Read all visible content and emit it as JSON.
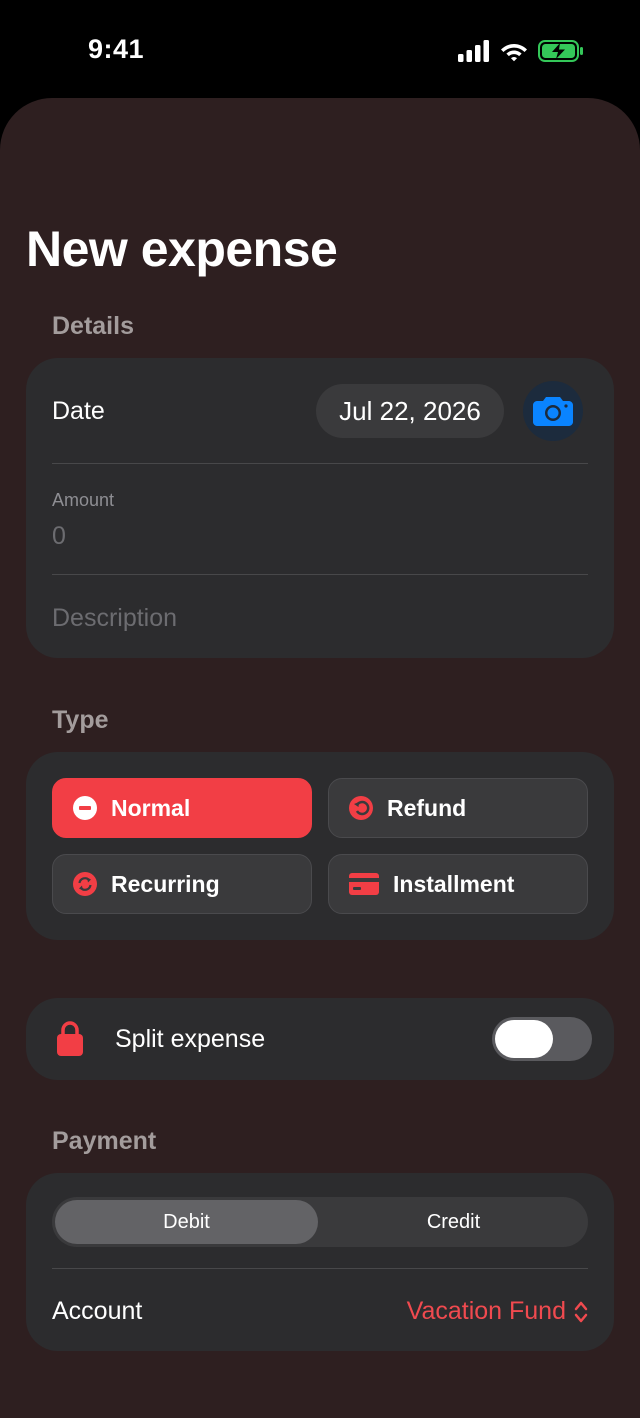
{
  "status_bar": {
    "time": "9:41"
  },
  "page": {
    "title": "New expense"
  },
  "details": {
    "section_label": "Details",
    "date_label": "Date",
    "date_value": "Jul 22, 2026",
    "amount_label": "Amount",
    "amount_placeholder": "0",
    "description_placeholder": "Description"
  },
  "type": {
    "section_label": "Type",
    "options": [
      {
        "label": "Normal",
        "icon": "minus-circle-icon",
        "selected": true
      },
      {
        "label": "Refund",
        "icon": "refund-icon",
        "selected": false
      },
      {
        "label": "Recurring",
        "icon": "recurring-icon",
        "selected": false
      },
      {
        "label": "Installment",
        "icon": "credit-card-icon",
        "selected": false
      }
    ]
  },
  "split": {
    "label": "Split expense",
    "enabled": false
  },
  "payment": {
    "section_label": "Payment",
    "segments": [
      "Debit",
      "Credit"
    ],
    "selected_segment": "Debit",
    "account_label": "Account",
    "account_value": "Vacation Fund"
  },
  "colors": {
    "accent": "#f23e45",
    "background": "#2e1f20",
    "card": "#2c2c2e",
    "camera_blue": "#0a84ff"
  }
}
